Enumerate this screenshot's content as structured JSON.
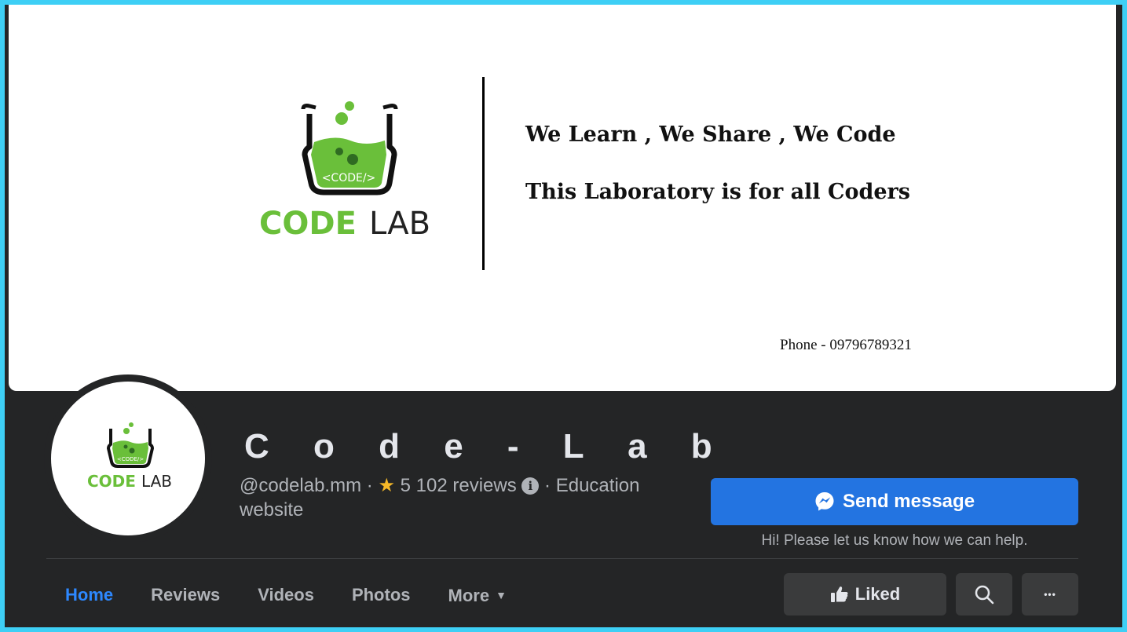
{
  "cover": {
    "brand_code": "CODE",
    "brand_lab": "LAB",
    "tag": "<CODE/>",
    "tagline_1": "We Learn , We Share , We Code",
    "tagline_2": "This Laboratory is for all Coders",
    "phone": "Phone - 09796789321"
  },
  "profile": {
    "name": "C o d e - L a b",
    "handle": "@codelab.mm",
    "separator": "·",
    "rating_star": "★",
    "reviews": "5 102 reviews",
    "info_icon": "i",
    "category": "Education website"
  },
  "actions": {
    "send_message": "Send message",
    "send_hint": "Hi! Please let us know how we can help.",
    "liked": "Liked",
    "more_glyph": "•••"
  },
  "tabs": [
    {
      "label": "Home",
      "active": true
    },
    {
      "label": "Reviews",
      "active": false
    },
    {
      "label": "Videos",
      "active": false
    },
    {
      "label": "Photos",
      "active": false
    },
    {
      "label": "More",
      "active": false
    }
  ],
  "colors": {
    "frame_bg": "#242526",
    "accent_blue": "#2374e1",
    "logo_green": "#6abf3a"
  }
}
